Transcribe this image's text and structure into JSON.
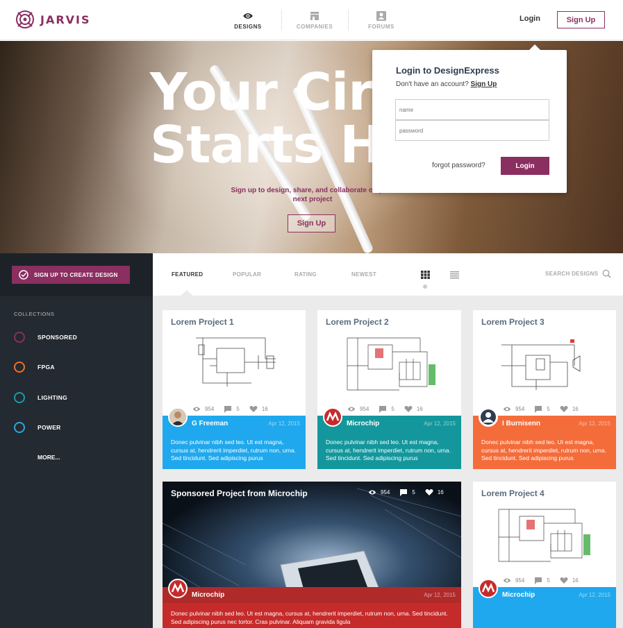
{
  "header": {
    "brand": "JARVIS",
    "nav": [
      {
        "label": "DESIGNS",
        "icon": "eye-icon"
      },
      {
        "label": "COMPANIES",
        "icon": "building-icon"
      },
      {
        "label": "FORUMS",
        "icon": "forum-icon"
      }
    ],
    "login_label": "Login",
    "signup_label": "Sign Up"
  },
  "hero": {
    "title_line1": "Your Cir",
    "title_line2": "Starts H",
    "subtitle": "Sign up to design, share, and collaborate on your next project",
    "signup_label": "Sign Up"
  },
  "login_popup": {
    "title": "Login to DesignExpress",
    "no_account_text": "Don't have an account?",
    "signup_link": "Sign Up",
    "name_placeholder": "name",
    "password_placeholder": "password",
    "forgot_label": "forgot password?",
    "login_label": "Login"
  },
  "sidebar": {
    "create_label": "SIGN UP TO CREATE DESIGN",
    "collections_label": "COLLECTIONS",
    "collections": [
      {
        "label": "SPONSORED",
        "color": "#8a2f5f"
      },
      {
        "label": "FPGA",
        "color": "#f37021"
      },
      {
        "label": "LIGHTING",
        "color": "#1a9ba5"
      },
      {
        "label": "POWER",
        "color": "#29a8df"
      }
    ],
    "more_label": "MORE..."
  },
  "tabs": {
    "items": [
      "FEATURED",
      "POPULAR",
      "RATING",
      "NEWEST"
    ],
    "active": "FEATURED",
    "search_label": "SEARCH DESIGNS"
  },
  "cards": [
    {
      "title": "Lorem Project 1",
      "views": "954",
      "comments": "5",
      "likes": "16",
      "author": "G Freeman",
      "date": "Apr 12, 2015",
      "description": "Donec pulvinar nibh sed leo. Ut est magna, cursus at, hendrerit imperdiet, rutrum non, urna. Sed tincidunt. Sed adipiscing purus",
      "color": "#1fa8ed"
    },
    {
      "title": "Lorem Project 2",
      "views": "954",
      "comments": "5",
      "likes": "16",
      "author": "Microchip",
      "date": "Apr 12, 2015",
      "description": "Donec pulvinar nibh sed leo. Ut est magna, cursus at, hendrerit imperdiet, rutrum non, urna. Sed tincidunt. Sed adipiscing purus",
      "color": "#13979c"
    },
    {
      "title": "Lorem Project 3",
      "views": "954",
      "comments": "5",
      "likes": "16",
      "author": "I Burnisenn",
      "date": "Apr 12, 2015",
      "description": "Donec pulvinar nibh sed leo. Ut est magna, cursus at, hendrerit imperdiet, rutrum non, urna. Sed tincidunt. Sed adipiscing purus",
      "color": "#f46c3a"
    },
    {
      "title": "Sponsored Project from Microchip",
      "views": "954",
      "comments": "5",
      "likes": "16",
      "author": "Microchip",
      "date": "Apr 12, 2015",
      "description": "Donec pulvinar nibh sed leo. Ut est magna, cursus at, hendrerit imperdiet, rutrum non, urna. Sed tincidunt. Sed adipiscing purus nec tortor. Cras pulvinar. Aliquam gravida ligula",
      "color": "#c62b2b"
    },
    {
      "title": "Lorem Project 4",
      "views": "954",
      "comments": "5",
      "likes": "16",
      "author": "Microchip",
      "date": "Apr 12, 2015",
      "description": "",
      "color": "#1fa8ed"
    }
  ]
}
